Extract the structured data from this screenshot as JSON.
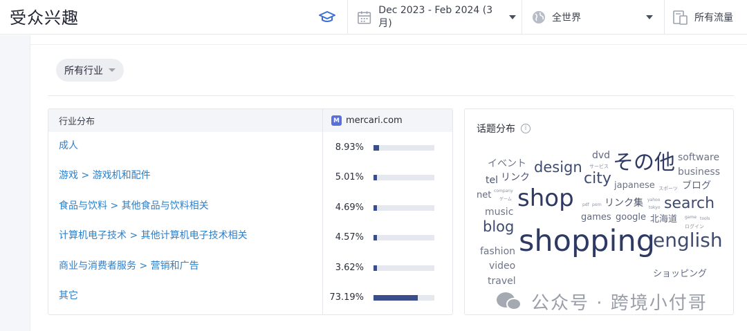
{
  "header": {
    "title": "受众兴趣",
    "date_range": "Dec 2023 - Feb 2024 (3 月)",
    "region": "全世界",
    "traffic": "所有流量"
  },
  "filter": {
    "industry_label": "所有行业"
  },
  "table": {
    "col_left": "行业分布",
    "site": "mercari.com",
    "site_favicon_letter": "M",
    "rows": [
      {
        "label": "成人",
        "pct": "8.93%",
        "value": 8.93
      },
      {
        "label": "游戏 > 游戏机和配件",
        "pct": "5.01%",
        "value": 5.01
      },
      {
        "label": "食品与饮料 > 其他食品与饮料相关",
        "pct": "4.69%",
        "value": 4.69
      },
      {
        "label": "计算机电子技术 > 其他计算机电子技术相关",
        "pct": "4.57%",
        "value": 4.57
      },
      {
        "label": "商业与消费者服务 > 营销和广告",
        "pct": "3.62%",
        "value": 3.62
      },
      {
        "label": "其它",
        "pct": "73.19%",
        "value": 73.19
      }
    ]
  },
  "topics": {
    "title": "话题分布",
    "info_glyph": "i",
    "words": [
      {
        "text": "イベント"
      },
      {
        "text": "design"
      },
      {
        "text": "dvd"
      },
      {
        "text": "サービス"
      },
      {
        "text": "その他"
      },
      {
        "text": "software"
      },
      {
        "text": "business"
      },
      {
        "text": "tel"
      },
      {
        "text": "リンク"
      },
      {
        "text": "city"
      },
      {
        "text": "japanese"
      },
      {
        "text": "スポーツ"
      },
      {
        "text": "ブログ"
      },
      {
        "text": "net"
      },
      {
        "text": "company"
      },
      {
        "text": "ゲーム"
      },
      {
        "text": "shop"
      },
      {
        "text": "pdf"
      },
      {
        "text": "porn"
      },
      {
        "text": "リンク集"
      },
      {
        "text": "yahoo"
      },
      {
        "text": "tokyo"
      },
      {
        "text": "search"
      },
      {
        "text": "music"
      },
      {
        "text": "games"
      },
      {
        "text": "google"
      },
      {
        "text": "北海道"
      },
      {
        "text": "game"
      },
      {
        "text": "tools"
      },
      {
        "text": "blog"
      },
      {
        "text": "ログイン"
      },
      {
        "text": "shopping"
      },
      {
        "text": "english"
      },
      {
        "text": "fashion"
      },
      {
        "text": "video"
      },
      {
        "text": "ショッピング"
      },
      {
        "text": "travel"
      }
    ]
  },
  "watermark": {
    "text": "公众号 · 跨境小付哥"
  },
  "colors": {
    "link": "#2f7fc8",
    "bar": "#3b4e8c",
    "accent_icon": "#3b6fd8"
  }
}
